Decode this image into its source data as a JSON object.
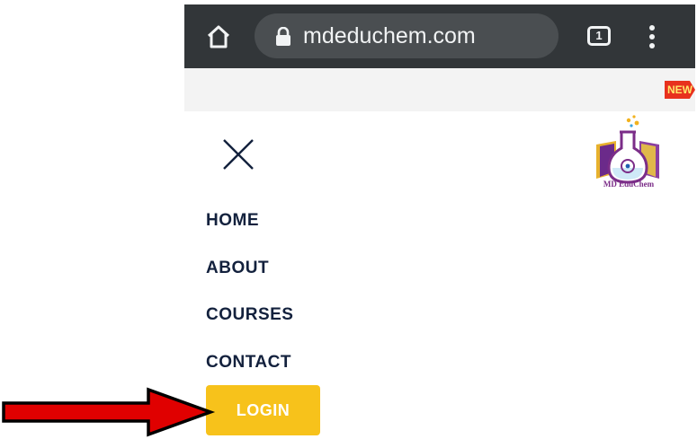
{
  "browser": {
    "url": "mdeduchem.com",
    "tab_count": "1",
    "home_icon": "home-icon",
    "lock_icon": "lock-icon",
    "menu_icon": "kebab-menu-icon"
  },
  "notice": {
    "badge": "NEW"
  },
  "site": {
    "logo_text": "MD EduChem",
    "close_icon": "close-icon"
  },
  "nav": {
    "items": [
      {
        "label": "HOME"
      },
      {
        "label": "ABOUT"
      },
      {
        "label": "COURSES"
      },
      {
        "label": "CONTACT"
      }
    ],
    "login_label": "LOGIN"
  },
  "colors": {
    "toolbar": "#323639",
    "omnibox": "#4a4e51",
    "nav_text": "#13213d",
    "login_bg": "#f7c21b",
    "annotation_arrow": "#e00000",
    "logo_text": "#7b2d88"
  }
}
